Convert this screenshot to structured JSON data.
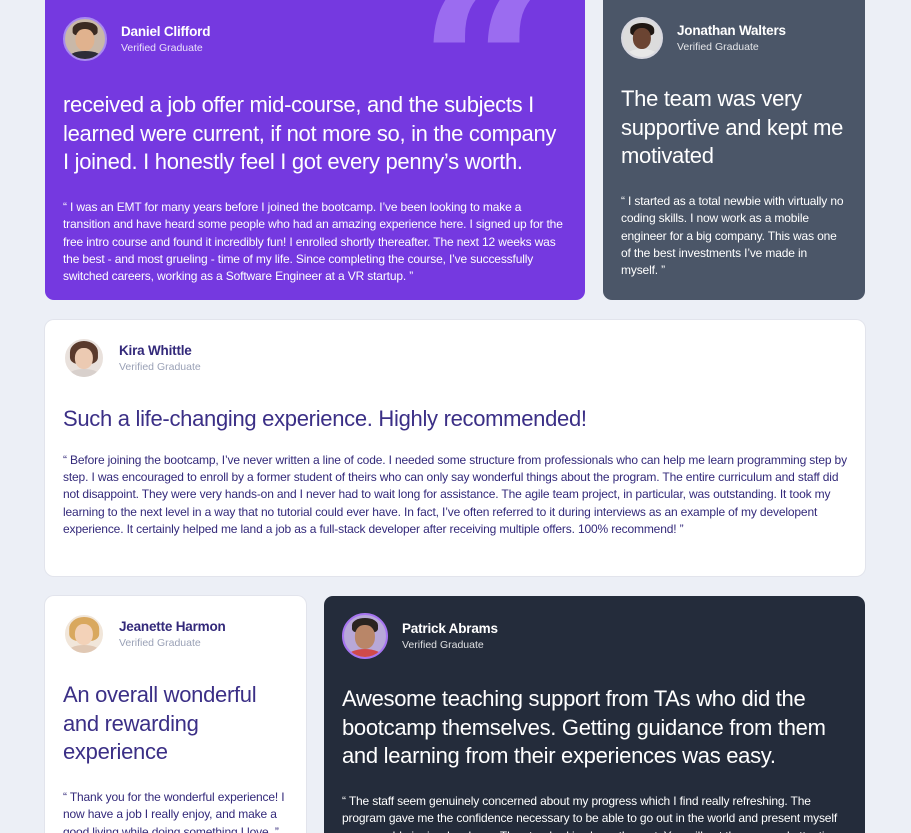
{
  "colors": {
    "page_bg": "#eceff6",
    "violet": "#7539e0",
    "slate": "#4b5668",
    "white": "#ffffff",
    "dark": "#242c3b",
    "heading_purple": "#3b2f86"
  },
  "testimonials": [
    {
      "name": "Daniel Clifford",
      "role": "Verified Graduate",
      "headline": "received a job offer mid-course, and the subjects I learned were current, if not more so, in the company I joined. I honestly feel I got every penny’s worth.",
      "body": "“ I was an EMT for many years before I joined the bootcamp. I’ve been looking to make a transition and have heard some people who had an amazing experience here. I signed up for the free intro course and found it incredibly fun! I enrolled shortly thereafter. The next 12 weeks was the best - and most grueling - time of my life. Since completing the course, I’ve successfully switched careers, working as a Software Engineer at a VR startup. ”",
      "avatar_icon": "person-avatar-icon"
    },
    {
      "name": "Jonathan Walters",
      "role": "Verified Graduate",
      "headline": "The team was very supportive and kept me motivated",
      "body": "“ I started as a total newbie with virtually no coding skills. I now work as a mobile engineer for a big company. This was one of the best investments I’ve made in myself. ”",
      "avatar_icon": "person-avatar-icon"
    },
    {
      "name": "Kira Whittle",
      "role": "Verified Graduate",
      "headline": "Such a life-changing experience. Highly recommended!",
      "body": "“ Before joining the bootcamp, I’ve never written a line of code. I needed some structure from professionals who can help me learn programming step by step. I was encouraged to enroll by a former student of theirs who can only say wonderful things about the program. The entire curriculum and staff did not disappoint. They were very hands-on and I never had to wait long for assistance. The agile team project, in particular, was outstanding. It took my learning to the next level in a way that no tutorial could ever have. In fact, I’ve often referred to it during interviews as an example of my developent experience. It certainly helped me land a job as a full-stack developer after receiving multiple offers. 100% recommend! ”",
      "avatar_icon": "person-avatar-icon"
    },
    {
      "name": "Jeanette Harmon",
      "role": "Verified Graduate",
      "headline": "An overall wonderful and rewarding experience",
      "body": "“ Thank you for the wonderful experience! I now have a job I really enjoy, and make a good living while doing something I love. ”",
      "avatar_icon": "person-avatar-icon"
    },
    {
      "name": "Patrick Abrams",
      "role": "Verified Graduate",
      "headline": "Awesome teaching support from TAs who did the bootcamp themselves. Getting guidance from them and learning from their experiences was easy.",
      "body": "“ The staff seem genuinely concerned about my progress which I find really refreshing. The program gave me the confidence necessary to be able to go out in the world and present myself as a capable junior developer. The standard is above the rest. You will get the personal attention you need from an incredible community of smart and amazing people. ”",
      "avatar_icon": "person-avatar-icon"
    }
  ]
}
